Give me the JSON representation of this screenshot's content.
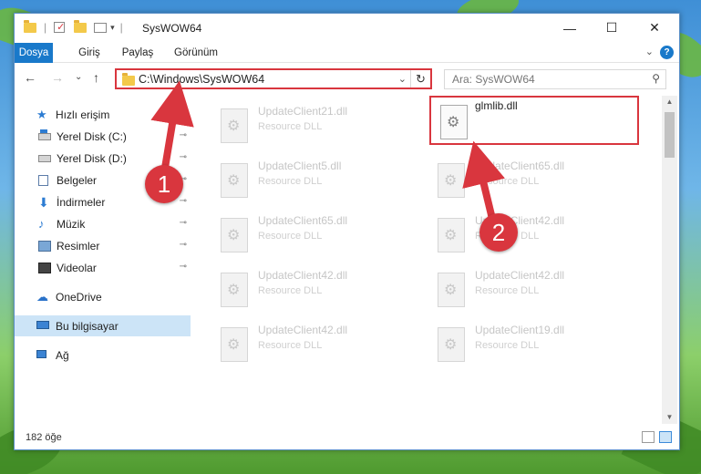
{
  "window": {
    "title": "SysWOW64",
    "min_glyph": "—",
    "max_glyph": "☐",
    "close_glyph": "✕"
  },
  "ribbon": {
    "tabs": [
      {
        "label": "Dosya",
        "active": true
      },
      {
        "label": "Giriş",
        "active": false
      },
      {
        "label": "Paylaş",
        "active": false
      },
      {
        "label": "Görünüm",
        "active": false
      }
    ],
    "collapse_glyph": "⌄",
    "help_glyph": "?"
  },
  "nav": {
    "back_glyph": "←",
    "forward_glyph": "→",
    "recent_glyph": "⌄",
    "up_glyph": "↑",
    "address": "C:\\Windows\\SysWOW64",
    "address_dropdown_glyph": "⌄",
    "refresh_glyph": "↻",
    "search_placeholder": "Ara: SysWOW64",
    "search_glyph": "⚲"
  },
  "sidebar": {
    "items": [
      {
        "label": "Hızlı erişim",
        "icon": "star-icon",
        "pinned": false
      },
      {
        "label": "Yerel Disk (C:)",
        "icon": "drive-c-icon",
        "pinned": true
      },
      {
        "label": "Yerel Disk (D:)",
        "icon": "drive-d-icon",
        "pinned": true
      },
      {
        "label": "Belgeler",
        "icon": "documents-icon",
        "pinned": true
      },
      {
        "label": "İndirmeler",
        "icon": "downloads-icon",
        "pinned": true
      },
      {
        "label": "Müzik",
        "icon": "music-icon",
        "pinned": true
      },
      {
        "label": "Resimler",
        "icon": "pictures-icon",
        "pinned": true
      },
      {
        "label": "Videolar",
        "icon": "videos-icon",
        "pinned": true
      },
      {
        "label": "OneDrive",
        "icon": "onedrive-icon",
        "pinned": false
      },
      {
        "label": "Bu bilgisayar",
        "icon": "this-pc-icon",
        "pinned": false,
        "selected": true
      },
      {
        "label": "Ağ",
        "icon": "network-icon",
        "pinned": false
      }
    ],
    "pin_glyph": "📌"
  },
  "files": {
    "left_column": [
      {
        "name": "UpdateClient21.dll",
        "type": "Resource DLL"
      },
      {
        "name": "UpdateClient5.dll",
        "type": "Resource DLL"
      },
      {
        "name": "UpdateClient65.dll",
        "type": "Resource DLL"
      },
      {
        "name": "UpdateClient42.dll",
        "type": "Resource DLL"
      },
      {
        "name": "UpdateClient42.dll",
        "type": "Resource DLL"
      }
    ],
    "right_column": [
      {
        "name": "glmlib.dll",
        "type": "",
        "highlighted": true
      },
      {
        "name": "UpdateClient65.dll",
        "type": "Resource DLL"
      },
      {
        "name": "UpdateClient42.dll",
        "type": "Resource DLL"
      },
      {
        "name": "UpdateClient42.dll",
        "type": "Resource DLL"
      },
      {
        "name": "UpdateClient19.dll",
        "type": "Resource DLL"
      }
    ]
  },
  "status": {
    "item_count": "182 öğe"
  },
  "annotations": {
    "step1": "1",
    "step2": "2",
    "color": "#d9363e"
  },
  "colors": {
    "accent": "#1979ca",
    "selection": "#cce4f7",
    "highlight_border": "#d9363e"
  }
}
